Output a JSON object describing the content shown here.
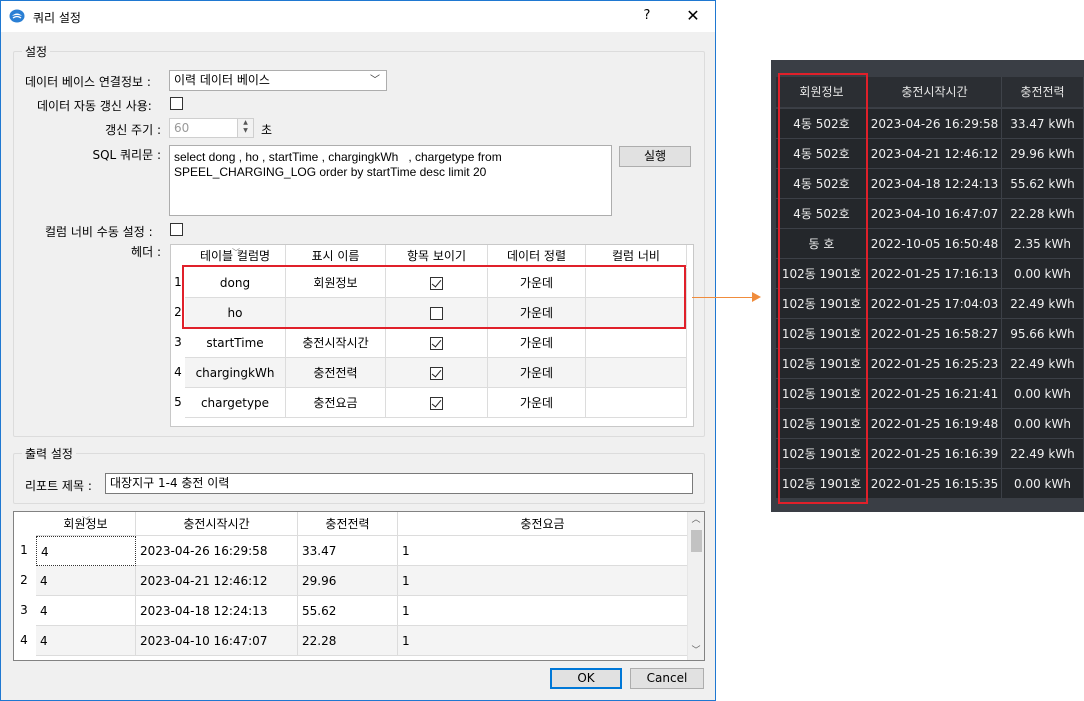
{
  "dialog": {
    "title": "쿼리 설정",
    "help_label": "?",
    "close_label": "✕"
  },
  "settings": {
    "group_title": "설정",
    "db_label": "데이터 베이스 연결정보 :",
    "db_value": "이력 데이터 베이스",
    "auto_refresh_label": "데이터 자동 갱신 사용:",
    "period_label": "갱신 주기 :",
    "period_value": "60",
    "period_unit": "초",
    "sql_label": "SQL 쿼리문 :",
    "sql_text": "select dong , ho , startTime , chargingkWh   , chargetype from\nSPEEL_CHARGING_LOG order by startTime desc limit 20",
    "run_button": "실행",
    "col_width_label": "컬럼 너비 수동 설정 :",
    "header_label": "헤더 :"
  },
  "header_grid": {
    "columns": [
      "테이블 컬럼명",
      "표시 이름",
      "항목 보이기",
      "데이터 정렬",
      "컬럼 너비"
    ],
    "rows": [
      {
        "num": "1",
        "column": "dong",
        "display": "회원정보",
        "visible": true,
        "align": "가운데",
        "width": ""
      },
      {
        "num": "2",
        "column": "ho",
        "display": "",
        "visible": false,
        "align": "가운데",
        "width": ""
      },
      {
        "num": "3",
        "column": "startTime",
        "display": "충전시작시간",
        "visible": true,
        "align": "가운데",
        "width": ""
      },
      {
        "num": "4",
        "column": "chargingkWh",
        "display": "충전전력",
        "visible": true,
        "align": "가운데",
        "width": ""
      },
      {
        "num": "5",
        "column": "chargetype",
        "display": "충전요금",
        "visible": true,
        "align": "가운데",
        "width": ""
      }
    ]
  },
  "output": {
    "group_title": "출력 설정",
    "report_label": "리포트 제목 :",
    "report_value": "대장지구 1-4 충전 이력"
  },
  "result_grid": {
    "columns": [
      "회원정보",
      "충전시작시간",
      "충전전력",
      "충전요금"
    ],
    "rows": [
      {
        "num": "1",
        "c1": "4",
        "c2": "2023-04-26 16:29:58",
        "c3": "33.47",
        "c4": "1"
      },
      {
        "num": "2",
        "c1": "4",
        "c2": "2023-04-21 12:46:12",
        "c3": "29.96",
        "c4": "1"
      },
      {
        "num": "3",
        "c1": "4",
        "c2": "2023-04-18 12:24:13",
        "c3": "55.62",
        "c4": "1"
      },
      {
        "num": "4",
        "c1": "4",
        "c2": "2023-04-10 16:47:07",
        "c3": "22.28",
        "c4": "1"
      }
    ]
  },
  "buttons": {
    "ok": "OK",
    "cancel": "Cancel"
  },
  "preview": {
    "columns": [
      "회원정보",
      "충전시작시간",
      "충전전력"
    ],
    "rows": [
      [
        "4동 502호",
        "2023-04-26 16:29:58",
        "33.47 kWh"
      ],
      [
        "4동 502호",
        "2023-04-21 12:46:12",
        "29.96 kWh"
      ],
      [
        "4동 502호",
        "2023-04-18 12:24:13",
        "55.62 kWh"
      ],
      [
        "4동 502호",
        "2023-04-10 16:47:07",
        "22.28 kWh"
      ],
      [
        "동 호",
        "2022-10-05 16:50:48",
        "2.35 kWh"
      ],
      [
        "102동 1901호",
        "2022-01-25 17:16:13",
        "0.00 kWh"
      ],
      [
        "102동 1901호",
        "2022-01-25 17:04:03",
        "22.49 kWh"
      ],
      [
        "102동 1901호",
        "2022-01-25 16:58:27",
        "95.66 kWh"
      ],
      [
        "102동 1901호",
        "2022-01-25 16:25:23",
        "22.49 kWh"
      ],
      [
        "102동 1901호",
        "2022-01-25 16:21:41",
        "0.00 kWh"
      ],
      [
        "102동 1901호",
        "2022-01-25 16:19:48",
        "0.00 kWh"
      ],
      [
        "102동 1901호",
        "2022-01-25 16:16:39",
        "22.49 kWh"
      ],
      [
        "102동 1901호",
        "2022-01-25 16:15:35",
        "0.00 kWh"
      ]
    ]
  },
  "colors": {
    "highlight": "#e0202a",
    "connector": "#f08c3c",
    "accent": "#0078d7"
  }
}
